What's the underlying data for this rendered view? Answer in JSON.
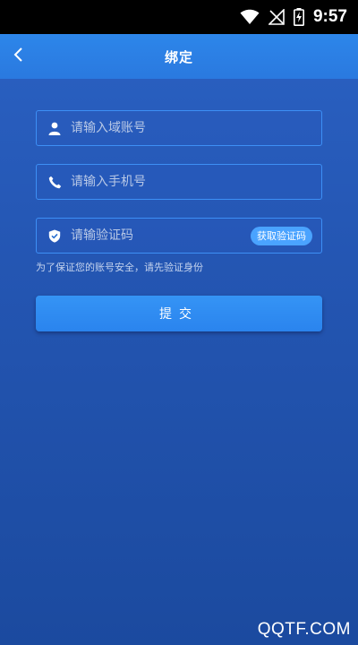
{
  "status_bar": {
    "time": "9:57"
  },
  "app_bar": {
    "title": "绑定"
  },
  "form": {
    "domain_placeholder": "请输入域账号",
    "phone_placeholder": "请输入手机号",
    "code_placeholder": "请输验证码",
    "get_code_label": "获取验证码",
    "hint": "为了保证您的账号安全，请先验证身份",
    "submit_label": "提交"
  },
  "watermark": "QQTF.COM",
  "icons": {
    "back": "chevron-left-icon",
    "user": "user-icon",
    "phone": "phone-icon",
    "shield": "shield-icon",
    "wifi": "wifi-icon",
    "signal": "no-signal-icon",
    "battery": "battery-charging-icon"
  },
  "colors": {
    "app_bar": "#2a79df",
    "field_border": "#3d8ff5",
    "button": "#2a84ee",
    "code_button": "#4aa3ff"
  }
}
